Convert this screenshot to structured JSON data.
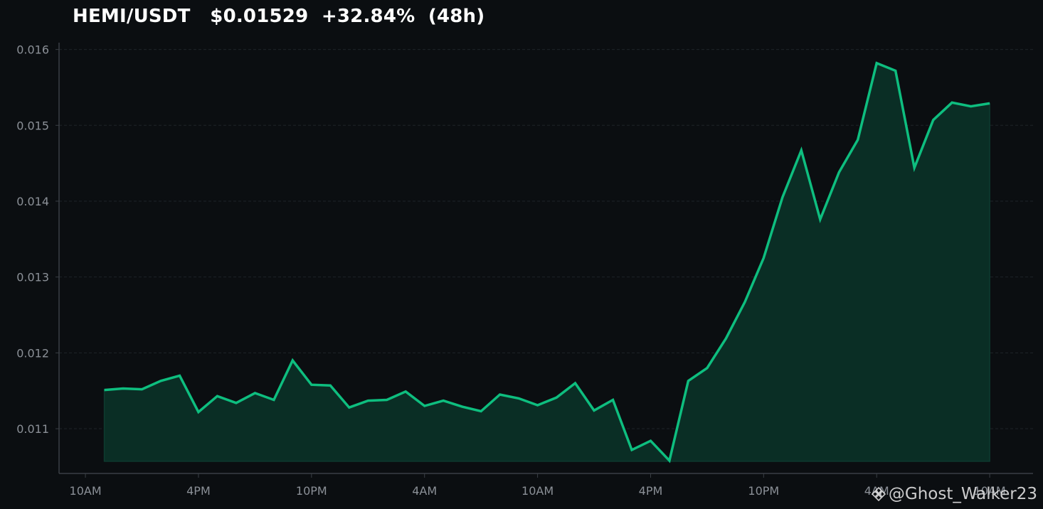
{
  "header": {
    "title": "HEMI/USDT   $0.01529  +32.84%  (48h)"
  },
  "watermark": {
    "handle": "@Ghost_Walker23",
    "logo_icon": "binance-logo-icon"
  },
  "colors": {
    "background": "#0b0e11",
    "line": "#0ebe7f",
    "fill": "#0a2e25",
    "axis": "#3a3f45",
    "tick_label": "#8b9097",
    "grid": "#1f2429"
  },
  "chart_data": {
    "type": "area",
    "title": "HEMI/USDT   $0.01529  +32.84%  (48h)",
    "xlabel": "",
    "ylabel": "",
    "grid": "horizontal dashed",
    "ylim": [
      0.01041,
      0.01609
    ],
    "yticks": [
      0.011,
      0.012,
      0.013,
      0.014,
      0.015,
      0.016
    ],
    "ytick_labels": [
      "0.011",
      "0.012",
      "0.013",
      "0.014",
      "0.015",
      "0.016"
    ],
    "xticks": [
      0,
      6,
      12,
      18,
      24,
      30,
      36,
      42,
      48
    ],
    "xtick_labels": [
      "10AM",
      "4PM",
      "10PM",
      "4AM",
      "10AM",
      "4PM",
      "10PM",
      "4AM",
      "10AM"
    ],
    "xlim": [
      -1.4,
      50.3
    ],
    "fill_baseline": 0.01057,
    "series": [
      {
        "x": [
          1,
          2,
          3,
          4,
          5,
          6,
          7,
          8,
          9,
          10,
          11,
          12,
          13,
          14,
          15,
          16,
          17,
          18,
          19,
          20,
          21,
          22,
          23,
          24,
          25,
          26,
          27,
          28,
          29,
          30,
          31,
          32,
          33,
          34,
          35,
          36,
          37,
          38,
          39,
          40,
          41,
          42,
          43,
          44,
          45,
          46,
          47,
          48
        ],
        "values": [
          0.01151,
          0.01153,
          0.01152,
          0.01163,
          0.0117,
          0.01122,
          0.01143,
          0.01134,
          0.01147,
          0.01138,
          0.0119,
          0.01158,
          0.01157,
          0.01128,
          0.01137,
          0.01138,
          0.01149,
          0.0113,
          0.01137,
          0.01129,
          0.01123,
          0.01145,
          0.0114,
          0.01131,
          0.01141,
          0.0116,
          0.01124,
          0.01138,
          0.01072,
          0.01084,
          0.01058,
          0.01163,
          0.0118,
          0.01219,
          0.01267,
          0.01325,
          0.01405,
          0.01467,
          0.01376,
          0.01438,
          0.01481,
          0.01582,
          0.01572,
          0.01444,
          0.01507,
          0.0153,
          0.01525,
          0.01529
        ]
      }
    ]
  }
}
